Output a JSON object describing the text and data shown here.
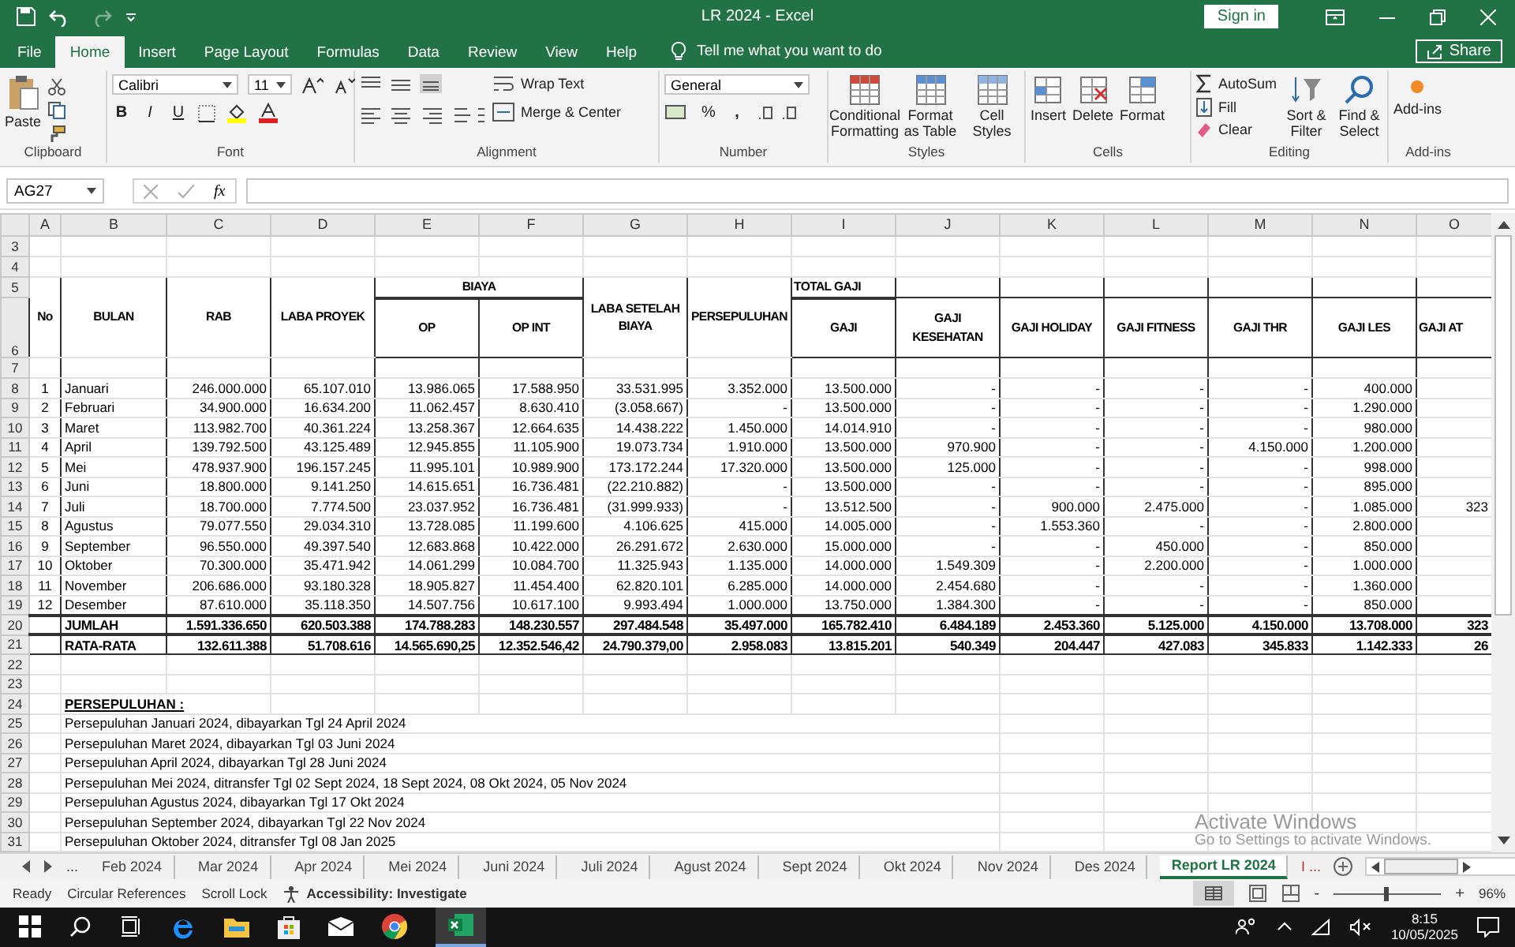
{
  "window": {
    "title": "LR 2024  -  Excel",
    "sign_in": "Sign in",
    "share": "Share"
  },
  "ribbon_tabs": [
    {
      "label": "File",
      "selected": false
    },
    {
      "label": "Home",
      "selected": true
    },
    {
      "label": "Insert",
      "selected": false
    },
    {
      "label": "Page Layout",
      "selected": false
    },
    {
      "label": "Formulas",
      "selected": false
    },
    {
      "label": "Data",
      "selected": false
    },
    {
      "label": "Review",
      "selected": false
    },
    {
      "label": "View",
      "selected": false
    },
    {
      "label": "Help",
      "selected": false
    }
  ],
  "tell_me": "Tell me what you want to do",
  "ribbon": {
    "clipboard": {
      "paste": "Paste",
      "label": "Clipboard"
    },
    "font": {
      "name": "Calibri",
      "size": "11",
      "bold": "B",
      "italic": "I",
      "underline": "U",
      "label": "Font"
    },
    "alignment": {
      "wrap_text": "Wrap Text",
      "merge_center": "Merge & Center",
      "label": "Alignment"
    },
    "number": {
      "format": "General",
      "percent": "%",
      "comma": ",",
      "label": "Number"
    },
    "styles": {
      "buttons": [
        "Conditional Formatting",
        "Format as Table",
        "Cell Styles"
      ],
      "label": "Styles"
    },
    "cells": {
      "buttons": [
        "Insert",
        "Delete",
        "Format"
      ],
      "label": "Cells"
    },
    "editing": {
      "autosum": "AutoSum",
      "fill": "Fill",
      "clear": "Clear",
      "sort": "Sort & Filter",
      "find": "Find & Select",
      "label": "Editing"
    },
    "addins": {
      "button": "Add-ins",
      "label": "Add-ins"
    }
  },
  "formula_bar": {
    "name_box": "AG27",
    "function_label": "fx"
  },
  "sheet": {
    "column_letters": [
      "A",
      "B",
      "C",
      "D",
      "E",
      "F",
      "G",
      "H",
      "I",
      "J",
      "K",
      "L",
      "M",
      "N",
      "O"
    ],
    "row_numbers": [
      "3",
      "4",
      "5",
      "6",
      "7",
      "8",
      "9",
      "10",
      "11",
      "12",
      "13",
      "14",
      "15",
      "16",
      "17",
      "18",
      "19",
      "20",
      "21",
      "22",
      "23",
      "24",
      "25",
      "26",
      "27",
      "28",
      "29",
      "30",
      "31"
    ],
    "group_headers": {
      "biaya": "BIAYA",
      "total_gaji": "TOTAL GAJI"
    },
    "columns": [
      "No",
      "BULAN",
      "RAB",
      "LABA PROYEK",
      "OP",
      "OP INT",
      "LABA SETELAH BIAYA",
      "PERSEPULUHAN",
      "GAJI",
      "GAJI KESEHATAN",
      "GAJI HOLIDAY",
      "GAJI FITNESS",
      "GAJI THR",
      "GAJI LES",
      "GAJI AT"
    ],
    "rows": [
      {
        "no": "1",
        "month": "Januari",
        "values": [
          "246.000.000",
          "65.107.010",
          "13.986.065",
          "17.588.950",
          "33.531.995",
          "3.352.000",
          "13.500.000",
          "-",
          "-",
          "-",
          "-",
          "400.000"
        ]
      },
      {
        "no": "2",
        "month": "Februari",
        "values": [
          "34.900.000",
          "16.634.200",
          "11.062.457",
          "8.630.410",
          "(3.058.667)",
          "-",
          "13.500.000",
          "-",
          "-",
          "-",
          "-",
          "1.290.000"
        ]
      },
      {
        "no": "3",
        "month": "Maret",
        "values": [
          "113.982.700",
          "40.361.224",
          "13.258.367",
          "12.664.635",
          "14.438.222",
          "1.450.000",
          "14.014.910",
          "-",
          "-",
          "-",
          "-",
          "980.000"
        ]
      },
      {
        "no": "4",
        "month": "April",
        "values": [
          "139.792.500",
          "43.125.489",
          "12.945.855",
          "11.105.900",
          "19.073.734",
          "1.910.000",
          "13.500.000",
          "970.900",
          "-",
          "-",
          "4.150.000",
          "1.200.000"
        ]
      },
      {
        "no": "5",
        "month": "Mei",
        "values": [
          "478.937.900",
          "196.157.245",
          "11.995.101",
          "10.989.900",
          "173.172.244",
          "17.320.000",
          "13.500.000",
          "125.000",
          "-",
          "-",
          "-",
          "998.000"
        ]
      },
      {
        "no": "6",
        "month": "Juni",
        "values": [
          "18.800.000",
          "9.141.250",
          "14.615.651",
          "16.736.481",
          "(22.210.882)",
          "-",
          "13.500.000",
          "-",
          "-",
          "-",
          "-",
          "895.000"
        ]
      },
      {
        "no": "7",
        "month": "Juli",
        "values": [
          "18.700.000",
          "7.774.500",
          "23.037.952",
          "16.736.481",
          "(31.999.933)",
          "-",
          "13.512.500",
          "-",
          "900.000",
          "2.475.000",
          "-",
          "1.085.000"
        ],
        "column_o": "323"
      },
      {
        "no": "8",
        "month": "Agustus",
        "values": [
          "79.077.550",
          "29.034.310",
          "13.728.085",
          "11.199.600",
          "4.106.625",
          "415.000",
          "14.005.000",
          "-",
          "1.553.360",
          "-",
          "-",
          "2.800.000"
        ]
      },
      {
        "no": "9",
        "month": "September",
        "values": [
          "96.550.000",
          "49.397.540",
          "12.683.868",
          "10.422.000",
          "26.291.672",
          "2.630.000",
          "15.000.000",
          "-",
          "-",
          "450.000",
          "-",
          "850.000"
        ]
      },
      {
        "no": "10",
        "month": "Oktober",
        "values": [
          "70.300.000",
          "35.471.942",
          "14.061.299",
          "10.084.700",
          "11.325.943",
          "1.135.000",
          "14.000.000",
          "1.549.309",
          "-",
          "2.200.000",
          "-",
          "1.000.000"
        ]
      },
      {
        "no": "11",
        "month": "November",
        "values": [
          "206.686.000",
          "93.180.328",
          "18.905.827",
          "11.454.400",
          "62.820.101",
          "6.285.000",
          "14.000.000",
          "2.454.680",
          "-",
          "-",
          "-",
          "1.360.000"
        ]
      },
      {
        "no": "12",
        "month": "Desember",
        "values": [
          "87.610.000",
          "35.118.350",
          "14.507.756",
          "10.617.100",
          "9.993.494",
          "1.000.000",
          "13.750.000",
          "1.384.300",
          "-",
          "-",
          "-",
          "850.000"
        ]
      }
    ],
    "totals": [
      {
        "label": "JUMLAH",
        "values": [
          "1.591.336.650",
          "620.503.388",
          "174.788.283",
          "148.230.557",
          "297.484.548",
          "35.497.000",
          "165.782.410",
          "6.484.189",
          "2.453.360",
          "5.125.000",
          "4.150.000",
          "13.708.000"
        ],
        "column_o": "323"
      },
      {
        "label": "RATA-RATA",
        "values": [
          "132.611.388",
          "51.708.616",
          "14.565.690,25",
          "12.352.546,42",
          "24.790.379,00",
          "2.958.083",
          "13.815.201",
          "540.349",
          "204.447",
          "427.083",
          "345.833",
          "1.142.333"
        ],
        "column_o": "26"
      }
    ],
    "notes": {
      "title": "PERSEPULUHAN :",
      "lines": [
        "Persepuluhan Januari 2024, dibayarkan Tgl 24 April 2024",
        "Persepuluhan Maret 2024, dibayarkan Tgl 03 Juni 2024",
        "Persepuluhan April 2024, dibayarkan Tgl  28 Juni 2024",
        "Persepuluhan Mei 2024, ditransfer Tgl 02 Sept 2024, 18 Sept 2024, 08 Okt 2024, 05 Nov 2024",
        "Persepuluhan Agustus 2024, dibayarkan Tgl 17 Okt 2024",
        "Persepuluhan September 2024, dibayarkan Tgl 22 Nov 2024",
        "Persepuluhan Oktober 2024, ditransfer Tgl 08 Jan 2025"
      ]
    }
  },
  "sheet_tabs": [
    {
      "label": "Feb 2024",
      "selected": false
    },
    {
      "label": "Mar 2024",
      "selected": false
    },
    {
      "label": "Apr 2024",
      "selected": false
    },
    {
      "label": "Mei 2024",
      "selected": false
    },
    {
      "label": "Juni 2024",
      "selected": false
    },
    {
      "label": "Juli 2024",
      "selected": false
    },
    {
      "label": "Agust 2024",
      "selected": false
    },
    {
      "label": "Sept 2024",
      "selected": false
    },
    {
      "label": "Okt 2024",
      "selected": false
    },
    {
      "label": "Nov 2024",
      "selected": false
    },
    {
      "label": "Des 2024",
      "selected": false
    },
    {
      "label": "Report LR 2024",
      "selected": true
    }
  ],
  "sheet_nav": {
    "more_left": "...",
    "more_right": "I ..."
  },
  "activation_notice": {
    "title": "Activate Windows",
    "text": "Go to Settings to activate Windows."
  },
  "status_bar": {
    "items": [
      "Ready",
      "Circular References",
      "Scroll Lock"
    ],
    "accessibility": "Accessibility: Investigate",
    "zoom_out": "-",
    "zoom_in": "+",
    "zoom_slider": {
      "level": 0.48
    },
    "zoom": "96%"
  },
  "taskbar": {
    "time": "8:15",
    "date": "10/05/2025"
  }
}
